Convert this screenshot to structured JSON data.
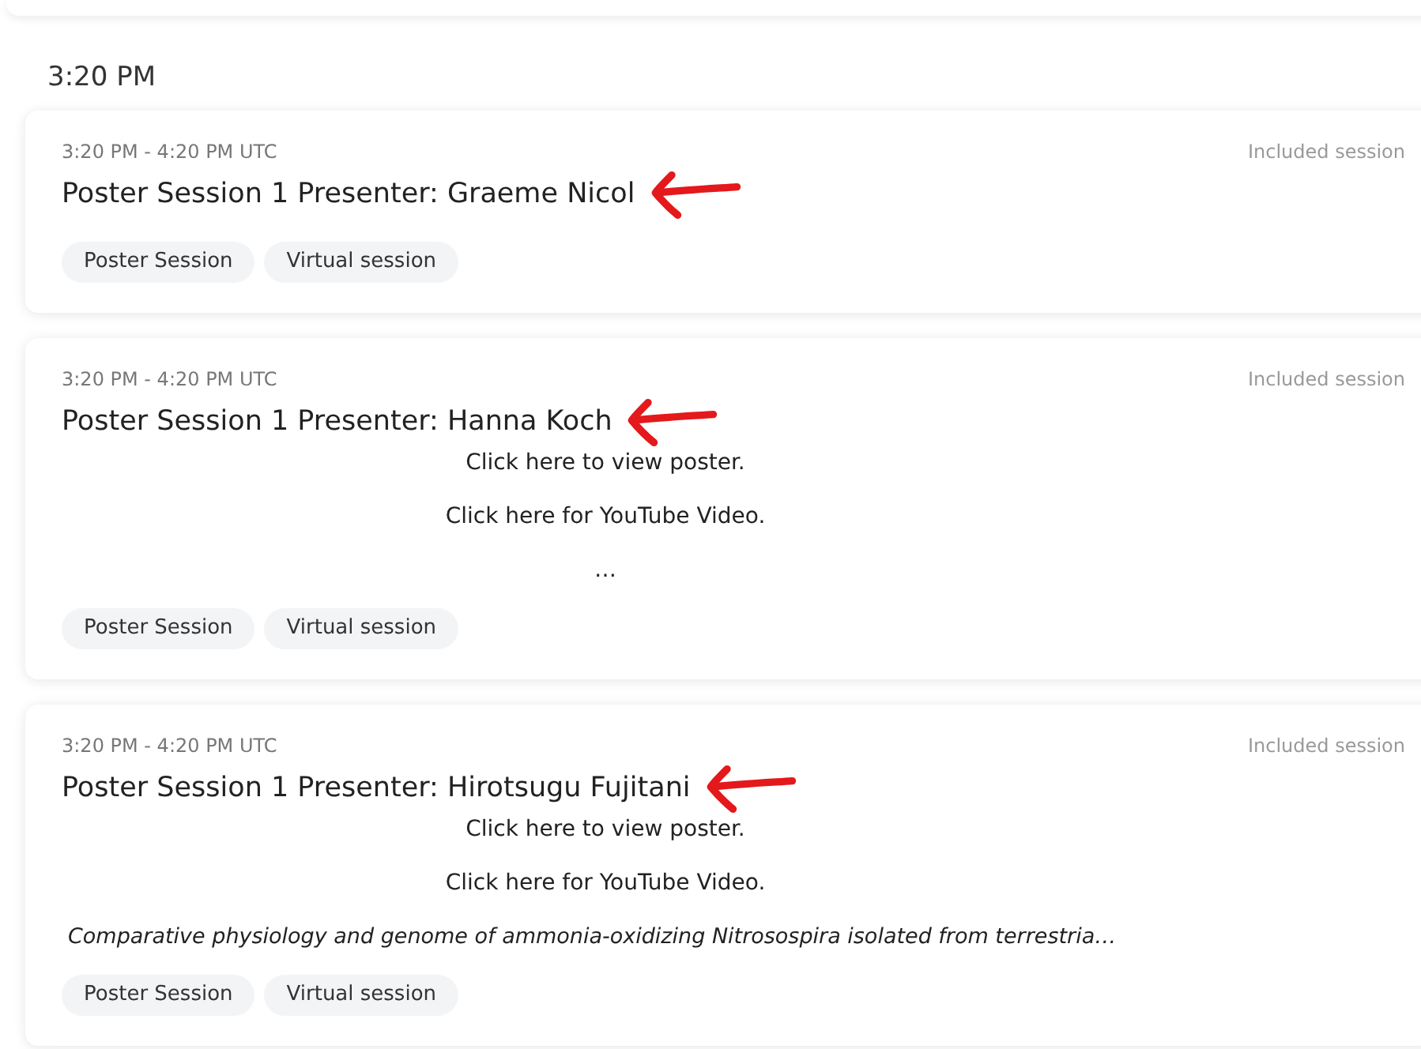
{
  "time_heading": "3:20 PM",
  "sessions": [
    {
      "time": "3:20 PM - 4:20 PM UTC",
      "access": "Included session",
      "title": "Poster Session 1 Presenter: Graeme Nicol",
      "tags": [
        "Poster Session",
        "Virtual session"
      ]
    },
    {
      "time": "3:20 PM - 4:20 PM UTC",
      "access": "Included session",
      "title": "Poster Session 1 Presenter: Hanna Koch",
      "description": [
        {
          "kind": "centered",
          "text": "Click here to view poster."
        },
        {
          "kind": "centered",
          "text": "Click here for YouTube Video."
        },
        {
          "kind": "centered",
          "text": "…"
        }
      ],
      "tags": [
        "Poster Session",
        "Virtual session"
      ]
    },
    {
      "time": "3:20 PM - 4:20 PM UTC",
      "access": "Included session",
      "title": "Poster Session 1 Presenter: Hirotsugu Fujitani",
      "description": [
        {
          "kind": "centered",
          "text": "Click here to view poster."
        },
        {
          "kind": "centered",
          "text": "Click here for YouTube Video."
        },
        {
          "kind": "italic",
          "text": "Comparative physiology and genome of ammonia-oxidizing Nitrosospira isolated from terrestria…"
        }
      ],
      "tags": [
        "Poster Session",
        "Virtual session"
      ]
    }
  ]
}
